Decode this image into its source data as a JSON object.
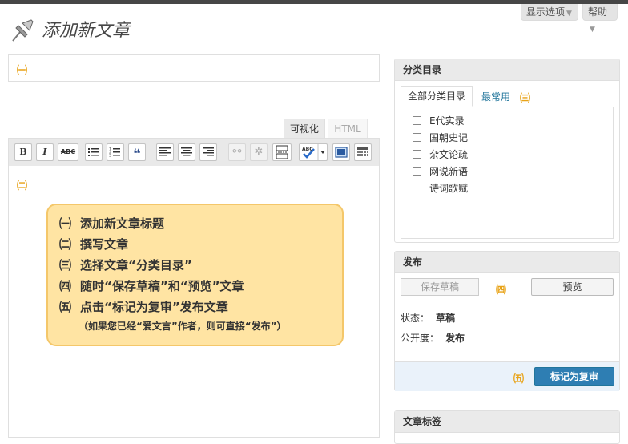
{
  "header": {
    "page_title": "添加新文章",
    "screen_options_label": "显示选项",
    "help_label": "帮助"
  },
  "title_area": {
    "marker": "㈠"
  },
  "editor": {
    "tab_visual": "可视化",
    "tab_html": "HTML",
    "marker": "㈡",
    "toolbar": {
      "bold": "B",
      "italic": "I",
      "strikethrough": "ABC"
    }
  },
  "help_note": {
    "items": [
      {
        "num": "㈠",
        "text": "添加新文章标题"
      },
      {
        "num": "㈡",
        "text": "撰写文章"
      },
      {
        "num": "㈢",
        "text": "选择文章“分类目录”"
      },
      {
        "num": "㈣",
        "text": "随时“保存草稿”和“预览”文章"
      },
      {
        "num": "㈤",
        "text": "点击“标记为复审”发布文章"
      }
    ],
    "sub_note": "（如果您已经“爱文言”作者，则可直接“发布”）"
  },
  "categories": {
    "title": "分类目录",
    "tab_all": "全部分类目录",
    "tab_popular": "最常用",
    "marker": "㈢",
    "items": [
      "E代实录",
      "国朝史记",
      "杂文论疏",
      "网说新语",
      "诗词歌赋"
    ]
  },
  "publish": {
    "title": "发布",
    "save_draft": "保存草稿",
    "preview": "预览",
    "marker_save": "㈣",
    "status_label": "状态：",
    "status_value": "草稿",
    "visibility_label": "公开度：",
    "visibility_value": "发布",
    "marker_submit": "㈤",
    "submit_label": "标记为复审"
  },
  "tags": {
    "title": "文章标签"
  },
  "colors": {
    "marker": "#e8a318",
    "note_bg": "#ffe4a3",
    "note_border": "#f4c76a",
    "primary_button": "#2e7eb3",
    "link": "#21759b"
  }
}
